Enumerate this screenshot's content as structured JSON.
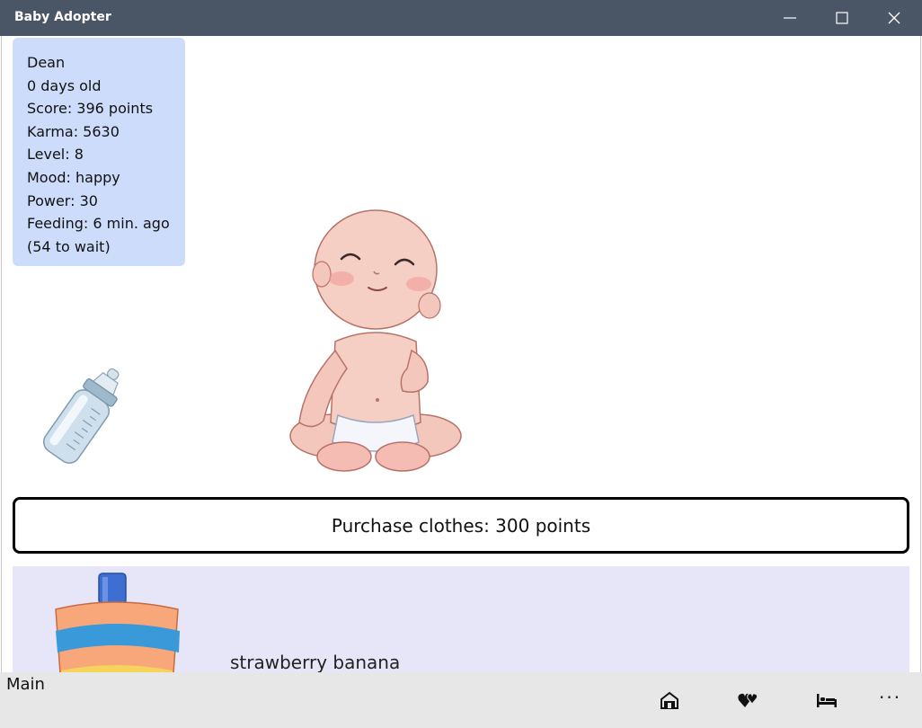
{
  "window": {
    "title": "Baby Adopter"
  },
  "stats": {
    "name": "Dean",
    "age": "0 days old",
    "score": "Score: 396 points",
    "karma": "Karma: 5630",
    "level": "Level: 8",
    "mood": "Mood: happy",
    "power": "Power: 30",
    "feeding": "Feeding: 6 min. ago",
    "wait": "(54 to wait)"
  },
  "purchase": {
    "label": "Purchase clothes: 300 points"
  },
  "food": {
    "name": "strawberry banana"
  },
  "appbar": {
    "label": "Main",
    "more": "···",
    "icons": [
      "home-icon",
      "hearts-icon",
      "bed-icon",
      "more-icon"
    ]
  },
  "colors": {
    "titlebar": "#4a5666",
    "stats_panel": "#cddcfa",
    "food_panel": "#e6e6f8",
    "appbar": "#e7e7e7"
  }
}
